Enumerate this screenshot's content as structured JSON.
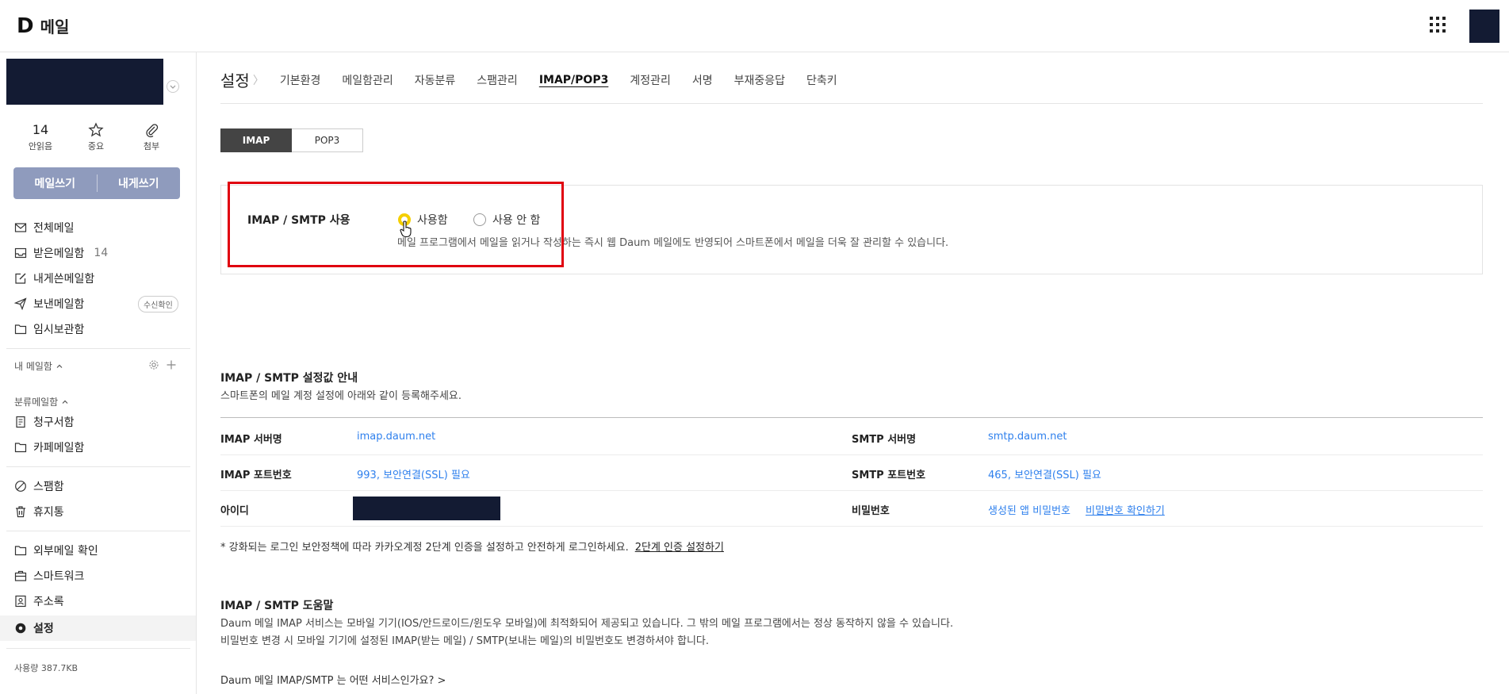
{
  "app": {
    "logo_letter": "D",
    "title": "메일"
  },
  "quick": [
    {
      "value": "14",
      "label": "안읽음"
    },
    {
      "label": "중요"
    },
    {
      "label": "첨부"
    }
  ],
  "compose": {
    "write": "메일쓰기",
    "to_self": "내게쓰기"
  },
  "nav": {
    "all": "전체메일",
    "inbox": "받은메일함",
    "inbox_count": "14",
    "to_me": "내게쓴메일함",
    "sent": "보낸메일함",
    "sent_badge": "수신확인",
    "drafts": "임시보관함",
    "my_folders": "내 메일함",
    "categories": "분류메일함",
    "bills": "청구서함",
    "cafe": "카페메일함",
    "spam": "스팸함",
    "trash": "휴지통",
    "external": "외부메일 확인",
    "smartwork": "스마트워크",
    "contacts": "주소록",
    "settings": "설정",
    "usage": "사용량 387.7KB"
  },
  "settings": {
    "title": "설정",
    "tabs": [
      "기본환경",
      "메일함관리",
      "자동분류",
      "스팸관리",
      "IMAP/POP3",
      "계정관리",
      "서명",
      "부재중응답",
      "단축키"
    ],
    "active_tab": "IMAP/POP3"
  },
  "protocol_toggle": {
    "imap": "IMAP",
    "pop3": "POP3"
  },
  "imap_setting": {
    "label": "IMAP / SMTP 사용",
    "option_on": "사용함",
    "option_off": "사용 안 함",
    "selected": "사용함",
    "help": "메일 프로그램에서 메일을 읽거나 작성하는 즉시 웹 Daum 메일에도 반영되어 스마트폰에서 메일을 더욱 잘 관리할 수 있습니다."
  },
  "guide": {
    "title": "IMAP / SMTP 설정값 안내",
    "subtitle": "스마트폰의 메일 계정 설정에 아래와 같이 등록해주세요.",
    "imap_server_label": "IMAP 서버명",
    "imap_server": "imap.daum.net",
    "smtp_server_label": "SMTP 서버명",
    "smtp_server": "smtp.daum.net",
    "imap_port_label": "IMAP 포트번호",
    "imap_port": "993, 보안연결(SSL) 필요",
    "smtp_port_label": "SMTP 포트번호",
    "smtp_port": "465, 보안연결(SSL) 필요",
    "id_label": "아이디",
    "password_label": "비밀번호",
    "password_value": "생성된 앱 비밀번호",
    "password_link": "비밀번호 확인하기",
    "note": "* 강화되는 로그인 보안정책에 따라 카카오계정 2단계 인증을 설정하고 안전하게 로그인하세요.",
    "note_link": "2단계 인증 설정하기"
  },
  "help": {
    "title": "IMAP / SMTP 도움말",
    "line1": "Daum 메일 IMAP 서비스는 모바일 기기(IOS/안드로이드/윈도우 모바일)에 최적화되어 제공되고 있습니다. 그 밖의 메일 프로그램에서는 정상 동작하지 않을 수 있습니다.",
    "line2": "비밀번호 변경 시 모바일 기기에 설정된 IMAP(받는 메일) / SMTP(보내는 메일)의 비밀번호도 변경하셔야 합니다.",
    "faq": "Daum 메일 IMAP/SMTP 는 어떤 서비스인가요? >"
  },
  "colors": {
    "accent_link": "#2f80ed",
    "compose_bg": "#8f9bbd",
    "radio_selected": "#f5cf00",
    "highlight": "#e0000f"
  }
}
